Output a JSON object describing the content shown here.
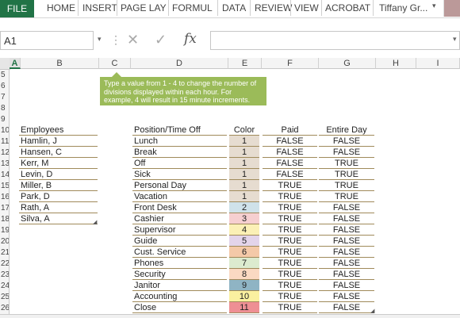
{
  "ribbon": {
    "file": "FILE",
    "tabs": [
      "HOME",
      "INSERT",
      "PAGE LAY",
      "FORMUL",
      "DATA",
      "REVIEW",
      "VIEW",
      "ACROBAT"
    ],
    "user": "Tiffany Gr...",
    "accent": "#217346"
  },
  "formula_bar": {
    "name_box": "A1",
    "fx": "fx",
    "formula": ""
  },
  "columns": [
    "A",
    "B",
    "C",
    "D",
    "E",
    "F",
    "G",
    "H",
    "I"
  ],
  "rows": [
    "5",
    "6",
    "7",
    "8",
    "9",
    "10",
    "11",
    "12",
    "13",
    "14",
    "15",
    "16",
    "17",
    "18",
    "19",
    "20",
    "21",
    "22",
    "23",
    "24",
    "25",
    "26"
  ],
  "tooltip": "Type a value from 1 - 4 to change the number of divisions displayed within each hour. For example, 4 will result in 15 minute increments.",
  "employees": {
    "header": "Employees",
    "items": [
      "Hamlin, J",
      "Hansen, C",
      "Kerr, M",
      "Levin, D",
      "Miller, B",
      "Park, D",
      "Rath, A",
      "Silva, A"
    ]
  },
  "positions": {
    "headers": {
      "position": "Position/Time Off",
      "color": "Color",
      "paid": "Paid",
      "entire_day": "Entire Day"
    },
    "rows": [
      {
        "name": "Lunch",
        "color": "1",
        "paid": "FALSE",
        "entire_day": "FALSE",
        "fill": "#e6dcd0"
      },
      {
        "name": "Break",
        "color": "1",
        "paid": "FALSE",
        "entire_day": "FALSE",
        "fill": "#e6dcd0"
      },
      {
        "name": "Off",
        "color": "1",
        "paid": "FALSE",
        "entire_day": "TRUE",
        "fill": "#e6dcd0"
      },
      {
        "name": "Sick",
        "color": "1",
        "paid": "FALSE",
        "entire_day": "TRUE",
        "fill": "#e6dcd0"
      },
      {
        "name": "Personal Day",
        "color": "1",
        "paid": "TRUE",
        "entire_day": "TRUE",
        "fill": "#e6dcd0"
      },
      {
        "name": "Vacation",
        "color": "1",
        "paid": "TRUE",
        "entire_day": "TRUE",
        "fill": "#e6dcd0"
      },
      {
        "name": "Front Desk",
        "color": "2",
        "paid": "TRUE",
        "entire_day": "FALSE",
        "fill": "#cfe2ea"
      },
      {
        "name": "Cashier",
        "color": "3",
        "paid": "TRUE",
        "entire_day": "FALSE",
        "fill": "#f6cfd0"
      },
      {
        "name": "Supervisor",
        "color": "4",
        "paid": "TRUE",
        "entire_day": "FALSE",
        "fill": "#fbf0b6"
      },
      {
        "name": "Guide",
        "color": "5",
        "paid": "TRUE",
        "entire_day": "FALSE",
        "fill": "#e3d4ea"
      },
      {
        "name": "Cust. Service",
        "color": "6",
        "paid": "TRUE",
        "entire_day": "FALSE",
        "fill": "#f4c9a8"
      },
      {
        "name": "Phones",
        "color": "7",
        "paid": "TRUE",
        "entire_day": "FALSE",
        "fill": "#dcebcf"
      },
      {
        "name": "Security",
        "color": "8",
        "paid": "TRUE",
        "entire_day": "FALSE",
        "fill": "#fad9c2"
      },
      {
        "name": "Janitor",
        "color": "9",
        "paid": "TRUE",
        "entire_day": "FALSE",
        "fill": "#8fb4c4"
      },
      {
        "name": "Accounting",
        "color": "10",
        "paid": "TRUE",
        "entire_day": "FALSE",
        "fill": "#faf0a0"
      },
      {
        "name": "Close",
        "color": "11",
        "paid": "TRUE",
        "entire_day": "FALSE",
        "fill": "#ee8f94"
      }
    ]
  }
}
